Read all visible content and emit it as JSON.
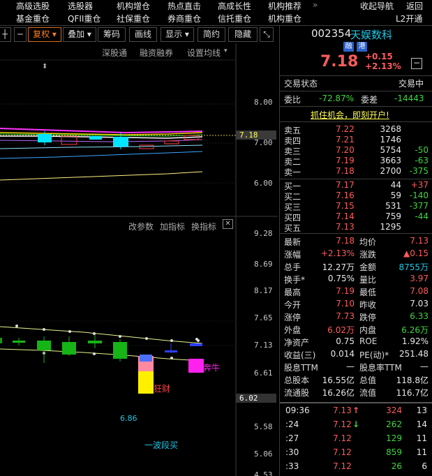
{
  "menu_top": [
    "高级选股",
    "选股器",
    "机构增仓",
    "热点直击",
    "高成长性",
    "机构推荐",
    "»",
    "收起导航",
    "返回"
  ],
  "menu_bottom": [
    "基金重仓",
    "QFII重仓",
    "社保重仓",
    "券商重仓",
    "信托重仓",
    "机构重仓",
    "L2开通"
  ],
  "toolbar": {
    "plus": "┼",
    "minus": "─",
    "fuquan": "复权",
    "diejia": "叠加",
    "chouma": "筹码",
    "huaxian": "画线",
    "xianshi": "显示",
    "jianyue": "简约",
    "yincang": "隐藏",
    "expand": "⤡"
  },
  "chart": {
    "top_tabs": [
      "深股通",
      "融资融券",
      "设置均线"
    ],
    "sub_tabs": [
      "改参数",
      "加指标",
      "换指标"
    ],
    "close": "✕",
    "price_axis": [
      "8.00",
      "7.00",
      "6.00"
    ],
    "current_price_tag": "7.18",
    "sub_axis": [
      "9.28",
      "8.69",
      "8.17",
      "7.65",
      "7.13",
      "6.61",
      "6.02",
      "5.58",
      "5.06",
      "4.53"
    ],
    "annotations": [
      "狂财",
      "奔牛",
      "6.86",
      "一波段买"
    ]
  },
  "quote": {
    "code": "002354",
    "name": "天娱数科",
    "badges": [
      "融",
      "港"
    ],
    "price": "7.18",
    "change": "+0.15",
    "change_pct": "+2.13%",
    "minus_button": "−",
    "status_label": "交易状态",
    "status_value": "交易中",
    "weibi_label": "委比",
    "weibi_value": "-72.87%",
    "weicha_label": "委差",
    "weicha_value": "-14443",
    "ad_text": "抓住机会，即刻开户!"
  },
  "asks": [
    {
      "label": "卖五",
      "price": "7.22",
      "vol": "3268",
      "chg": ""
    },
    {
      "label": "卖四",
      "price": "7.21",
      "vol": "1746",
      "chg": ""
    },
    {
      "label": "卖三",
      "price": "7.20",
      "vol": "5754",
      "chg": "-50"
    },
    {
      "label": "卖二",
      "price": "7.19",
      "vol": "3663",
      "chg": "-63"
    },
    {
      "label": "卖一",
      "price": "7.18",
      "vol": "2700",
      "chg": "-375"
    }
  ],
  "bids": [
    {
      "label": "买一",
      "price": "7.17",
      "vol": "44",
      "chg": "+37"
    },
    {
      "label": "买二",
      "price": "7.16",
      "vol": "59",
      "chg": "-140"
    },
    {
      "label": "买三",
      "price": "7.15",
      "vol": "531",
      "chg": "-377"
    },
    {
      "label": "买四",
      "price": "7.14",
      "vol": "759",
      "chg": "-44"
    },
    {
      "label": "买五",
      "price": "7.13",
      "vol": "1295",
      "chg": ""
    }
  ],
  "stats": [
    {
      "l1": "最新",
      "v1": "7.18",
      "c1": "red",
      "l2": "均价",
      "v2": "7.13",
      "c2": "red"
    },
    {
      "l1": "涨幅",
      "v1": "+2.13%",
      "c1": "red",
      "l2": "涨跌",
      "v2": "▲0.15",
      "c2": "red"
    },
    {
      "l1": "总手",
      "v1": "12.27万",
      "c1": "white",
      "l2": "金额",
      "v2": "8755万",
      "c2": "cyan"
    },
    {
      "l1": "换手*",
      "v1": "0.75%",
      "c1": "white",
      "l2": "量比",
      "v2": "3.97",
      "c2": "red"
    },
    {
      "l1": "最高",
      "v1": "7.19",
      "c1": "red",
      "l2": "最低",
      "v2": "7.08",
      "c2": "red"
    },
    {
      "l1": "今开",
      "v1": "7.10",
      "c1": "red",
      "l2": "昨收",
      "v2": "7.03",
      "c2": "white"
    },
    {
      "l1": "涨停",
      "v1": "7.73",
      "c1": "red",
      "l2": "跌停",
      "v2": "6.33",
      "c2": "green"
    },
    {
      "l1": "外盘",
      "v1": "6.02万",
      "c1": "red",
      "l2": "内盘",
      "v2": "6.26万",
      "c2": "green"
    },
    {
      "l1": "净资产",
      "v1": "0.75",
      "c1": "white",
      "l2": "ROE",
      "v2": "1.92%",
      "c2": "white"
    },
    {
      "l1": "收益(三)",
      "v1": "0.014",
      "c1": "white",
      "l2": "PE(动)*",
      "v2": "251.48",
      "c2": "white"
    },
    {
      "l1": "股息TTM",
      "v1": "—",
      "c1": "white",
      "l2": "股息率TTM",
      "v2": "—",
      "c2": "white"
    },
    {
      "l1": "总股本",
      "v1": "16.55亿",
      "c1": "white",
      "l2": "总值",
      "v2": "118.8亿",
      "c2": "white"
    },
    {
      "l1": "流通股",
      "v1": "16.26亿",
      "c1": "white",
      "l2": "流值",
      "v2": "116.7亿",
      "c2": "white"
    }
  ],
  "ticks": [
    {
      "time": "09:36",
      "price": "7.13",
      "dir": "↑",
      "vol": "324",
      "vcolor": "red",
      "n": "13"
    },
    {
      "time": ":24",
      "price": "7.12",
      "dir": "↓",
      "vol": "262",
      "vcolor": "green",
      "n": "14"
    },
    {
      "time": ":27",
      "price": "7.12",
      "dir": "",
      "vol": "129",
      "vcolor": "green",
      "n": "11"
    },
    {
      "time": ":30",
      "price": "7.12",
      "dir": "",
      "vol": "859",
      "vcolor": "green",
      "n": "11"
    },
    {
      "time": ":33",
      "price": "7.12",
      "dir": "",
      "vol": "26",
      "vcolor": "green",
      "n": "6"
    }
  ]
}
